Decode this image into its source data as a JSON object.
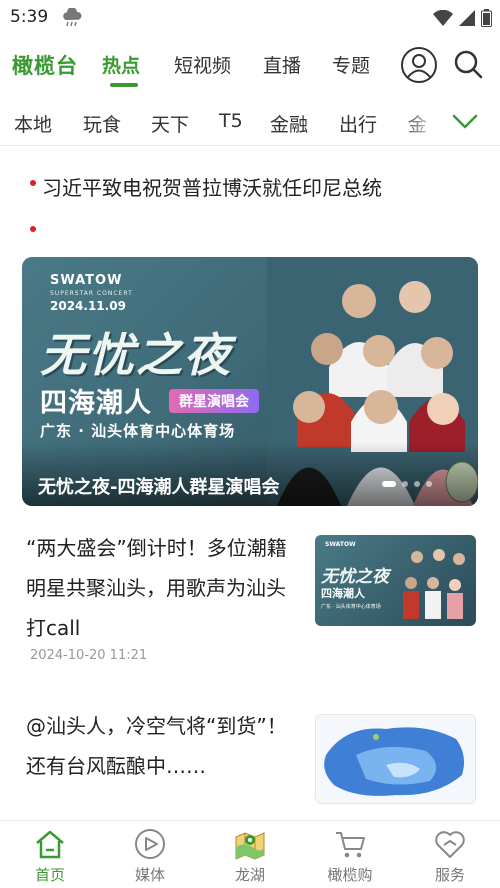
{
  "status_bar": {
    "time": "5:39"
  },
  "top_nav": {
    "brand": "橄榄台",
    "tabs": [
      {
        "label": "热点",
        "active": true
      },
      {
        "label": "短视频",
        "active": false
      },
      {
        "label": "直播",
        "active": false
      },
      {
        "label": "专题",
        "active": false
      }
    ],
    "icons": [
      "user-icon",
      "search-icon"
    ]
  },
  "channels": [
    "本地",
    "玩食",
    "天下",
    "T5",
    "金融",
    "出行",
    "金"
  ],
  "headlines": [
    "习近平致电祝贺普拉博沃就任印尼总统"
  ],
  "banner": {
    "brand": "SWATOW",
    "brand_sub": "SUPERSTAR CONCERT",
    "date": "2024.11.09",
    "big_title": "无忧之夜",
    "mid_title": "四海潮人",
    "tag": "群星演唱会",
    "venue": "广东 · 汕头体育中心体育场",
    "caption": "无忧之夜-四海潮人群星演唱会"
  },
  "articles": [
    {
      "title": "“两大盛会”倒计时！多位潮籍明星共聚汕头，用歌声为汕头打call",
      "time": "2024-10-20 11:21",
      "thumb": {
        "brand": "SWATOW",
        "big": "无忧之夜",
        "mid": "四海潮人",
        "venue": "广东 · 汕头体育中心体育场"
      }
    },
    {
      "title": "@汕头人，冷空气将“到货”！还有台风酝酿中……"
    }
  ],
  "bottom_nav": [
    {
      "label": "首页",
      "icon": "home-icon",
      "active": true
    },
    {
      "label": "媒体",
      "icon": "play-icon",
      "active": false
    },
    {
      "label": "龙湖",
      "icon": "map-icon",
      "active": false
    },
    {
      "label": "橄榄购",
      "icon": "cart-icon",
      "active": false
    },
    {
      "label": "服务",
      "icon": "heart-icon",
      "active": false
    }
  ],
  "colors": {
    "accent": "#3a9a32",
    "dot": "#e02020",
    "text": "#222222",
    "muted": "#999999"
  }
}
